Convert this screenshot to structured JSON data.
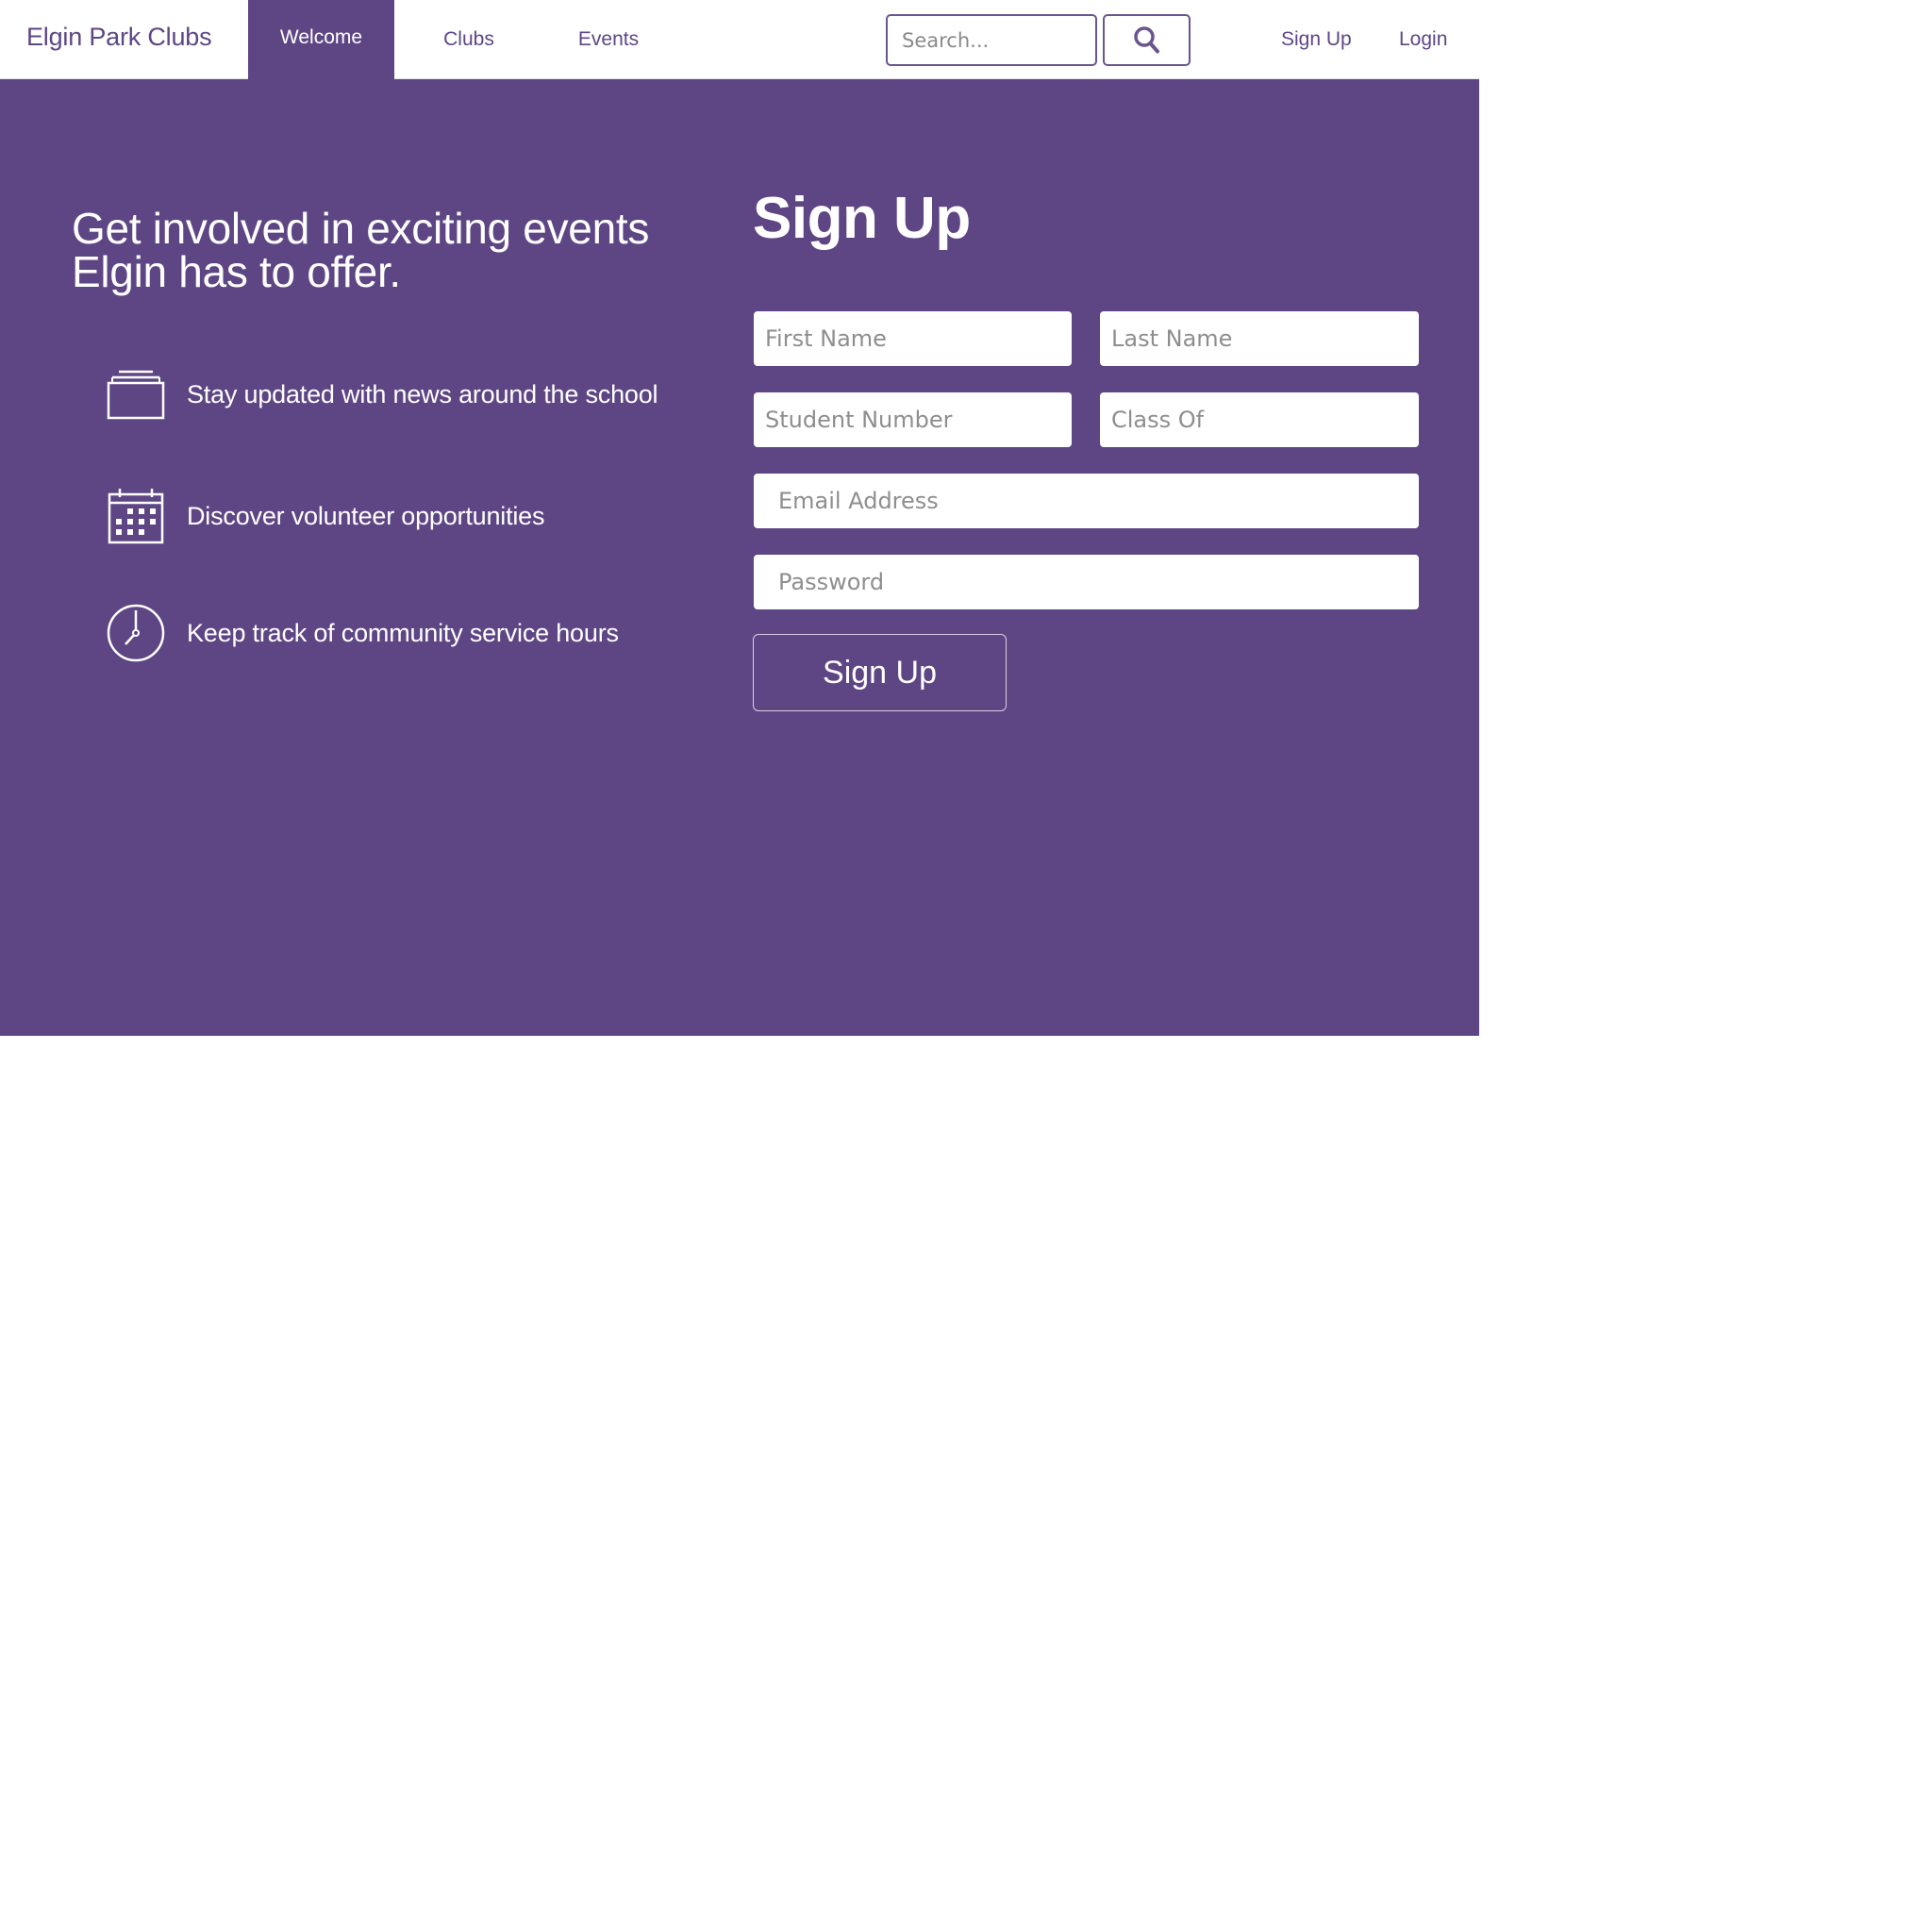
{
  "colors": {
    "brand_purple": "#5e4685",
    "text_on_dark": "#ffffff",
    "background": "#ffffff"
  },
  "nav": {
    "brand": "Elgin Park Clubs",
    "tabs": [
      {
        "label": "Welcome",
        "active": true
      },
      {
        "label": "Clubs",
        "active": false
      },
      {
        "label": "Events",
        "active": false
      }
    ],
    "search": {
      "placeholder": "Search...",
      "button_icon": "search-icon"
    },
    "links": {
      "signup": "Sign Up",
      "login": "Login"
    }
  },
  "hero": {
    "headline": "Get involved in exciting events Elgin has to offer.",
    "features": [
      {
        "icon": "news-stack-icon",
        "text": "Stay updated with news around the school"
      },
      {
        "icon": "calendar-icon",
        "text": "Discover volunteer opportunities"
      },
      {
        "icon": "clock-icon",
        "text": "Keep track of community service hours"
      }
    ]
  },
  "signup_form": {
    "title": "Sign Up",
    "fields": {
      "first_name": "First Name",
      "last_name": "Last Name",
      "student_number": "Student Number",
      "class_of": "Class Of",
      "email": "Email Address",
      "password": "Password"
    },
    "submit_label": "Sign Up"
  }
}
